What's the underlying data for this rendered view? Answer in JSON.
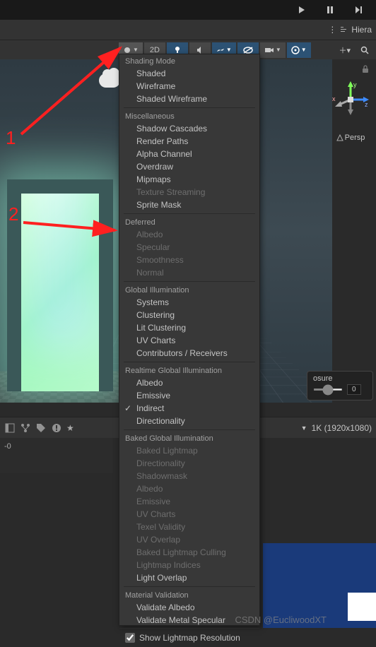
{
  "playback": {
    "play": "play-icon",
    "pause": "pause-icon",
    "step": "step-icon"
  },
  "tabs": {
    "hierarchy": "Hiera"
  },
  "toolbar": {
    "btn_2d": "2D",
    "shading_dropdown": "shading",
    "light": "light-icon",
    "audio": "audio-icon",
    "fx": "fx-icon",
    "hidden": "hidden-icon",
    "camera": "camera-icon",
    "gizmo": "gizmo-icon"
  },
  "gizmo": {
    "axes": {
      "x": "x",
      "y": "y",
      "z": "z"
    },
    "projection": "Persp"
  },
  "exposure": {
    "label": "osure",
    "value": "0"
  },
  "menu": {
    "sections": [
      {
        "title": "Shading Mode",
        "items": [
          {
            "label": "Shaded",
            "disabled": false
          },
          {
            "label": "Wireframe",
            "disabled": false
          },
          {
            "label": "Shaded Wireframe",
            "disabled": false
          }
        ]
      },
      {
        "title": "Miscellaneous",
        "items": [
          {
            "label": "Shadow Cascades",
            "disabled": false
          },
          {
            "label": "Render Paths",
            "disabled": false
          },
          {
            "label": "Alpha Channel",
            "disabled": false
          },
          {
            "label": "Overdraw",
            "disabled": false
          },
          {
            "label": "Mipmaps",
            "disabled": false
          },
          {
            "label": "Texture Streaming",
            "disabled": true
          },
          {
            "label": "Sprite Mask",
            "disabled": false
          }
        ]
      },
      {
        "title": "Deferred",
        "items": [
          {
            "label": "Albedo",
            "disabled": true
          },
          {
            "label": "Specular",
            "disabled": true
          },
          {
            "label": "Smoothness",
            "disabled": true
          },
          {
            "label": "Normal",
            "disabled": true
          }
        ]
      },
      {
        "title": "Global Illumination",
        "items": [
          {
            "label": "Systems",
            "disabled": false
          },
          {
            "label": "Clustering",
            "disabled": false
          },
          {
            "label": "Lit Clustering",
            "disabled": false
          },
          {
            "label": "UV Charts",
            "disabled": false
          },
          {
            "label": "Contributors / Receivers",
            "disabled": false
          }
        ]
      },
      {
        "title": "Realtime Global Illumination",
        "items": [
          {
            "label": "Albedo",
            "disabled": false
          },
          {
            "label": "Emissive",
            "disabled": false
          },
          {
            "label": "Indirect",
            "disabled": false,
            "checked": true
          },
          {
            "label": "Directionality",
            "disabled": false
          }
        ]
      },
      {
        "title": "Baked Global Illumination",
        "items": [
          {
            "label": "Baked Lightmap",
            "disabled": true
          },
          {
            "label": "Directionality",
            "disabled": true
          },
          {
            "label": "Shadowmask",
            "disabled": true
          },
          {
            "label": "Albedo",
            "disabled": true
          },
          {
            "label": "Emissive",
            "disabled": true
          },
          {
            "label": "UV Charts",
            "disabled": true
          },
          {
            "label": "Texel Validity",
            "disabled": true
          },
          {
            "label": "UV Overlap",
            "disabled": true
          },
          {
            "label": "Baked Lightmap Culling",
            "disabled": true
          },
          {
            "label": "Lightmap Indices",
            "disabled": true
          },
          {
            "label": "Light Overlap",
            "disabled": false
          }
        ]
      },
      {
        "title": "Material Validation",
        "items": [
          {
            "label": "Validate Albedo",
            "disabled": false
          },
          {
            "label": "Validate Metal Specular",
            "disabled": false
          }
        ]
      }
    ],
    "checkbox_label": "Show Lightmap Resolution",
    "checkbox_checked": true
  },
  "bottom": {
    "resolution": "1K (1920x1080)"
  },
  "annotations": {
    "one": "1",
    "two": "2"
  },
  "console": {
    "line": "-0"
  },
  "watermark": "CSDN @EucliwoodXT"
}
